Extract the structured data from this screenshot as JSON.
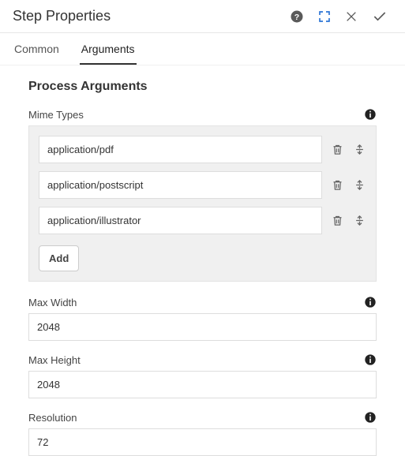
{
  "header": {
    "title": "Step Properties"
  },
  "tabs": [
    {
      "label": "Common",
      "active": false
    },
    {
      "label": "Arguments",
      "active": true
    }
  ],
  "section_title": "Process Arguments",
  "mime_types": {
    "label": "Mime Types",
    "items": [
      "application/pdf",
      "application/postscript",
      "application/illustrator"
    ],
    "add_label": "Add"
  },
  "max_width": {
    "label": "Max Width",
    "value": "2048"
  },
  "max_height": {
    "label": "Max Height",
    "value": "2048"
  },
  "resolution": {
    "label": "Resolution",
    "value": "72"
  },
  "icons": {
    "help": "help-icon",
    "fullscreen": "fullscreen-icon",
    "close": "close-icon",
    "confirm": "check-icon",
    "info": "info-icon",
    "trash": "trash-icon",
    "reorder": "reorder-icon"
  }
}
